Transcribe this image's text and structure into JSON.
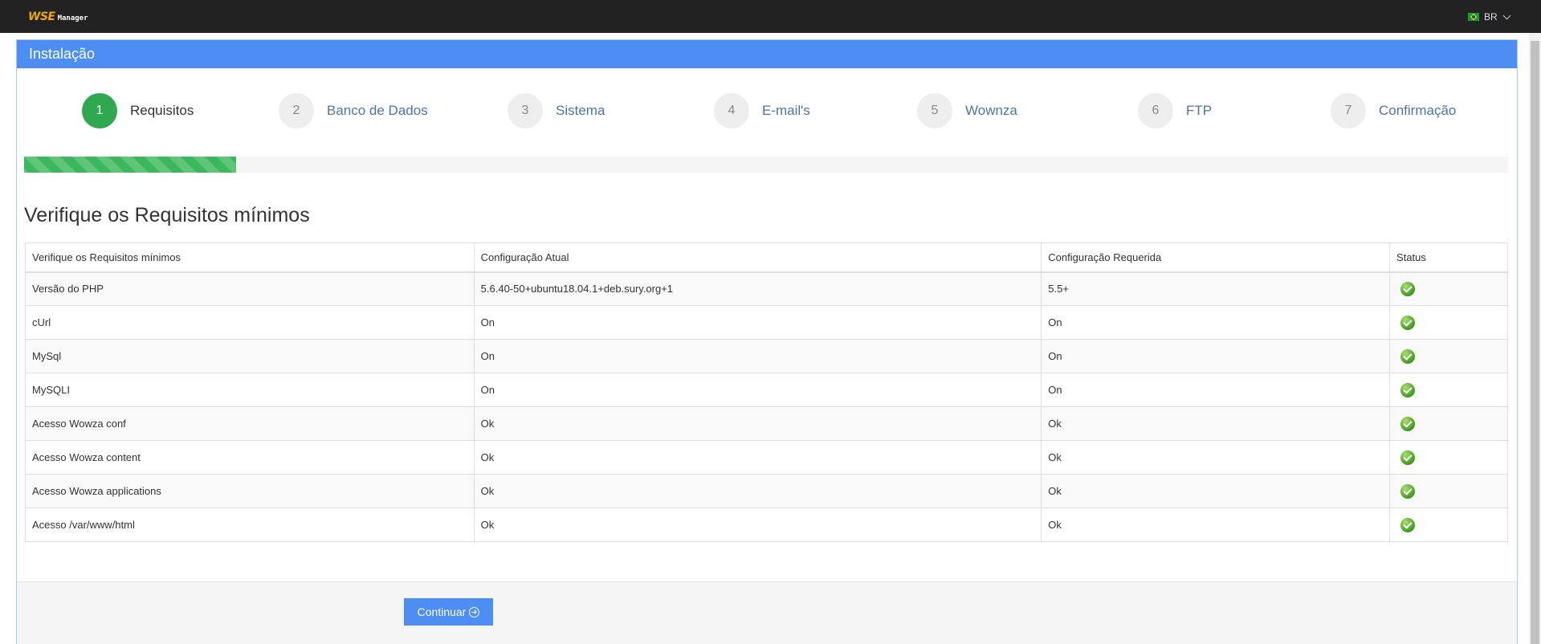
{
  "topbar": {
    "logo_mark": "WSE",
    "logo_sub": "Manager",
    "language": "BR"
  },
  "panel": {
    "title": "Instalação"
  },
  "steps": [
    {
      "number": "1",
      "label": "Requisitos"
    },
    {
      "number": "2",
      "label": "Banco de Dados"
    },
    {
      "number": "3",
      "label": "Sistema"
    },
    {
      "number": "4",
      "label": "E-mail's"
    },
    {
      "number": "5",
      "label": "Wownza"
    },
    {
      "number": "6",
      "label": "FTP"
    },
    {
      "number": "7",
      "label": "Confirmação"
    }
  ],
  "progress": {
    "percent": 14.3
  },
  "requirements": {
    "title": "Verifique os Requisitos mínimos",
    "headers": [
      "Verifique os Requisitos mínimos",
      "Configuração Atual",
      "Configuração Requerida",
      "Status"
    ],
    "rows": [
      {
        "name": "Versão do PHP",
        "current": "5.6.40-50+ubuntu18.04.1+deb.sury.org+1",
        "required": "5.5+",
        "status": "ok"
      },
      {
        "name": "cUrl",
        "current": "On",
        "required": "On",
        "status": "ok"
      },
      {
        "name": "MySql",
        "current": "On",
        "required": "On",
        "status": "ok"
      },
      {
        "name": "MySQLI",
        "current": "On",
        "required": "On",
        "status": "ok"
      },
      {
        "name": "Acesso Wowza conf",
        "current": "Ok",
        "required": "Ok",
        "status": "ok"
      },
      {
        "name": "Acesso Wowza content",
        "current": "Ok",
        "required": "Ok",
        "status": "ok"
      },
      {
        "name": "Acesso Wowza applications",
        "current": "Ok",
        "required": "Ok",
        "status": "ok"
      },
      {
        "name": "Acesso /var/www/html",
        "current": "Ok",
        "required": "Ok",
        "status": "ok"
      }
    ]
  },
  "footer": {
    "continue_label": "Continuar"
  },
  "colors": {
    "accent": "#4d8ef5",
    "success": "#2fa84f",
    "topbar": "#222222",
    "logo": "#f0a800"
  }
}
